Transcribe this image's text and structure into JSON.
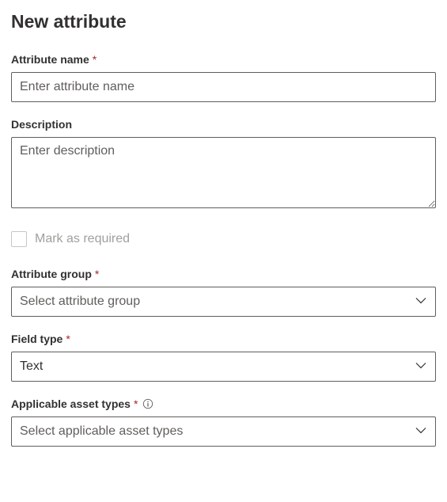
{
  "title": "New attribute",
  "fields": {
    "attributeName": {
      "label": "Attribute name",
      "required": true,
      "placeholder": "Enter attribute name",
      "value": ""
    },
    "description": {
      "label": "Description",
      "required": false,
      "placeholder": "Enter description",
      "value": ""
    },
    "markRequired": {
      "label": "Mark as required",
      "checked": false,
      "disabled": true
    },
    "attributeGroup": {
      "label": "Attribute group",
      "required": true,
      "placeholder": "Select attribute group",
      "value": ""
    },
    "fieldType": {
      "label": "Field type",
      "required": true,
      "value": "Text"
    },
    "applicableAssetTypes": {
      "label": "Applicable asset types",
      "required": true,
      "hasInfo": true,
      "placeholder": "Select applicable asset types",
      "value": ""
    }
  },
  "requiredMarker": "*"
}
